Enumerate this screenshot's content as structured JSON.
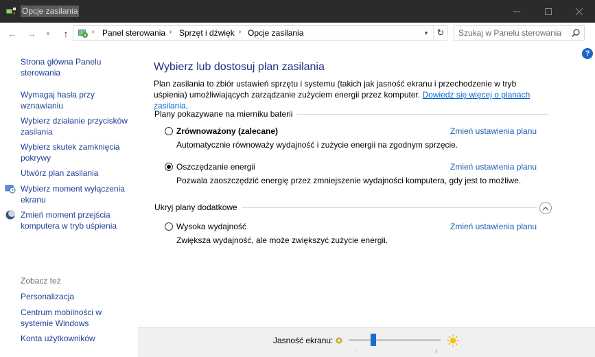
{
  "window": {
    "title": "Opcje zasilania",
    "controls": {
      "minimize": "—",
      "maximize": "☐",
      "close": "✕"
    }
  },
  "navigation": {
    "back_icon": "←",
    "forward_icon": "→",
    "recent_icon": "▾",
    "up_icon": "↑",
    "breadcrumbs": [
      "Panel sterowania",
      "Sprzęt i dźwięk",
      "Opcje zasilania"
    ],
    "separator": "›",
    "dropdown_icon": "▾",
    "refresh_icon": "↻",
    "search_placeholder": "Szukaj w Panelu sterowania"
  },
  "sidebar": {
    "home_link": "Strona główna Panelu sterowania",
    "items": [
      {
        "label": "Wymagaj hasła przy wznawianiu",
        "icon": ""
      },
      {
        "label": "Wybierz działanie przycisków zasilania",
        "icon": ""
      },
      {
        "label": "Wybierz skutek zamknięcia pokrywy",
        "icon": ""
      },
      {
        "label": "Utwórz plan zasilania",
        "icon": ""
      },
      {
        "label": "Wybierz moment wyłączenia ekranu",
        "icon": "monitor-clock-icon"
      },
      {
        "label": "Zmień moment przejścia komputera w tryb uśpienia",
        "icon": "moon-icon"
      }
    ],
    "see_also_heading": "Zobacz też",
    "see_also": [
      "Personalizacja",
      "Centrum mobilności w systemie Windows",
      "Konta użytkowników"
    ]
  },
  "main": {
    "help_icon": "?",
    "title": "Wybierz lub dostosuj plan zasilania",
    "intro": "Plan zasilania to zbiór ustawień sprzętu i systemu (takich jak jasność ekranu i przechodzenie w tryb uśpienia) umożliwiających zarządzanie zużyciem energii przez komputer.",
    "learn_more_link": "Dowiedz się więcej o planach zasilania",
    "intro_end": ".",
    "section_battery": "Plany pokazywane na mierniku baterii",
    "section_additional": "Ukryj plany dodatkowe",
    "change_label": "Zmień ustawienia planu",
    "plans": [
      {
        "name": "Zrównoważony (zalecane)",
        "description": "Automatycznie równoważy wydajność i zużycie energii na zgodnym sprzęcie.",
        "selected": false,
        "bold": true
      },
      {
        "name": "Oszczędzanie energii",
        "description": "Pozwala zaoszczędzić energię przez zmniejszenie wydajności komputera, gdy jest to możliwe.",
        "selected": true,
        "bold": false
      },
      {
        "name": "Wysoka wydajność",
        "description": "Zwiększa wydajność, ale może zwiększyć zużycie energii.",
        "selected": false,
        "bold": false
      }
    ]
  },
  "brightness": {
    "label": "Jasność ekranu:",
    "level": 0.27
  },
  "colors": {
    "title_bar": "#2b2b2b",
    "link": "#1a3f93",
    "heading": "#1e3287",
    "slider_thumb": "#1c6ad1"
  }
}
